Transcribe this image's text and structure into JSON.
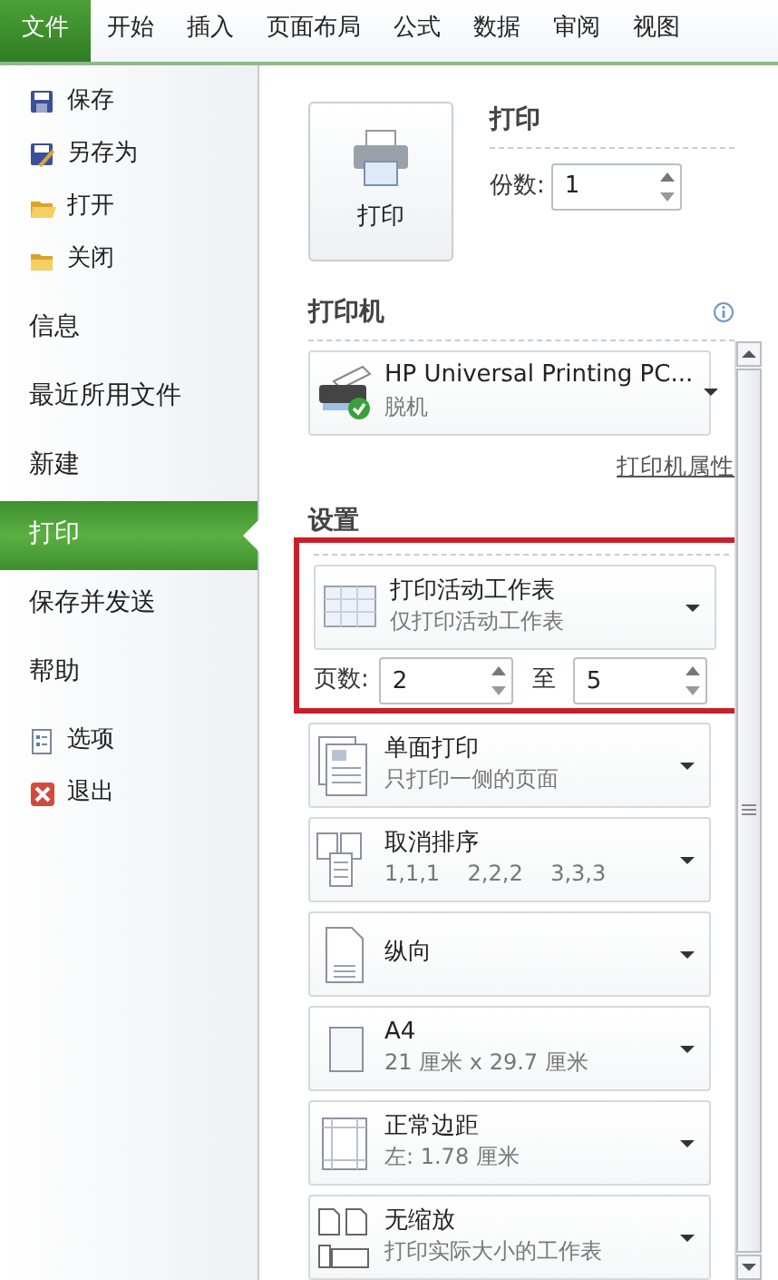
{
  "ribbon_tabs": [
    {
      "label": "文件",
      "selected": true
    },
    {
      "label": "开始",
      "selected": false
    },
    {
      "label": "插入",
      "selected": false
    },
    {
      "label": "页面布局",
      "selected": false
    },
    {
      "label": "公式",
      "selected": false
    },
    {
      "label": "数据",
      "selected": false
    },
    {
      "label": "审阅",
      "selected": false
    },
    {
      "label": "视图",
      "selected": false
    }
  ],
  "sidebar": {
    "items": [
      {
        "label": "保存",
        "kind": "small",
        "selected": false
      },
      {
        "label": "另存为",
        "kind": "small",
        "selected": false
      },
      {
        "label": "打开",
        "kind": "small",
        "selected": false
      },
      {
        "label": "关闭",
        "kind": "small",
        "selected": false
      },
      {
        "label": "信息",
        "kind": "large",
        "selected": false
      },
      {
        "label": "最近所用文件",
        "kind": "large",
        "selected": false
      },
      {
        "label": "新建",
        "kind": "large",
        "selected": false
      },
      {
        "label": "打印",
        "kind": "large",
        "selected": true
      },
      {
        "label": "保存并发送",
        "kind": "large",
        "selected": false
      },
      {
        "label": "帮助",
        "kind": "large",
        "selected": false
      },
      {
        "label": "选项",
        "kind": "small",
        "selected": false
      },
      {
        "label": "退出",
        "kind": "small",
        "selected": false
      }
    ]
  },
  "print": {
    "button": "打印",
    "heading": "打印",
    "copies_label": "份数:",
    "copies": "1"
  },
  "printer": {
    "heading": "打印机",
    "name": "HP Universal Printing PC...",
    "status": "脱机",
    "properties_link": "打印机属性"
  },
  "settings": {
    "heading": "设置",
    "scope": {
      "title": "打印活动工作表",
      "subtitle": "仅打印活动工作表",
      "highlighted": true,
      "pages_label": "页数:",
      "from": "2",
      "to_label": "至",
      "to": "5"
    },
    "options": [
      {
        "title": "单面打印",
        "subtitle": "只打印一侧的页面"
      },
      {
        "title": "取消排序",
        "subtitle": "1,1,1    2,2,2    3,3,3"
      },
      {
        "title": "纵向"
      },
      {
        "title": "A4",
        "subtitle": "21 厘米 x 29.7 厘米"
      },
      {
        "title": "正常边距",
        "subtitle": "左: 1.78 厘米"
      },
      {
        "title": "无缩放",
        "subtitle": "打印实际大小的工作表"
      }
    ]
  }
}
